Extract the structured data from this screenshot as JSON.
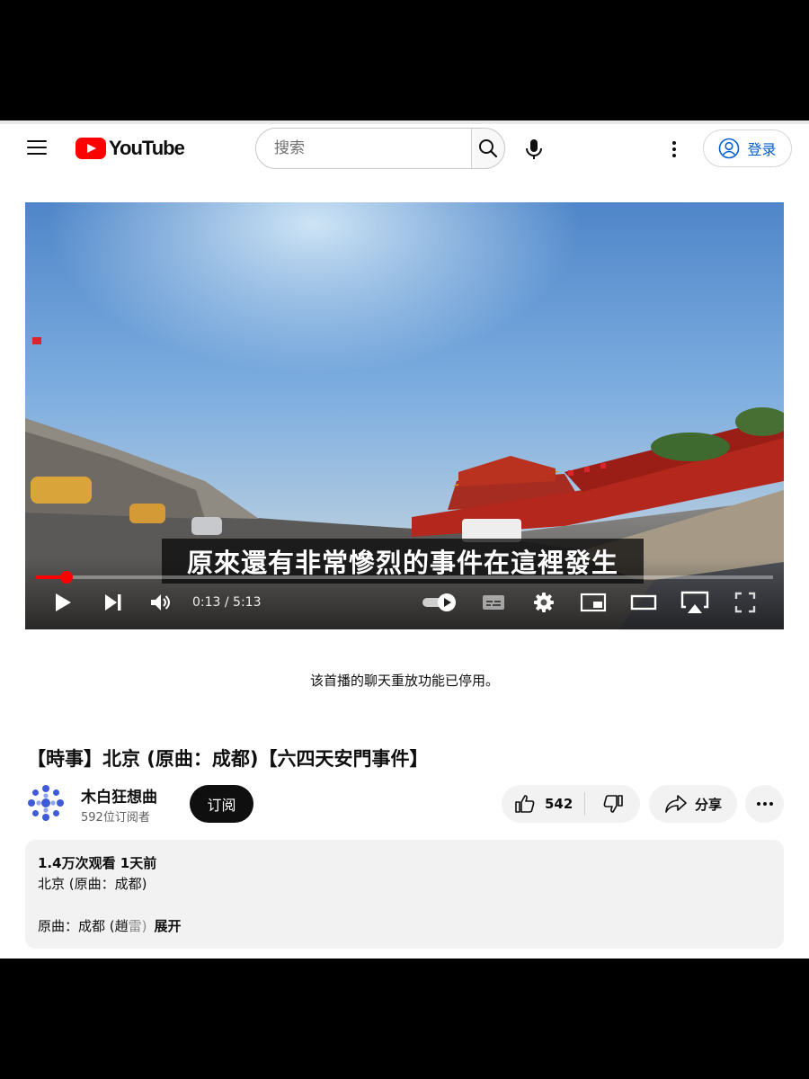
{
  "masthead": {
    "logo_text": "YouTube",
    "search_placeholder": "搜索",
    "signin_label": "登录"
  },
  "player": {
    "subtitle": "原來還有非常慘烈的事件在這裡發生",
    "time_display": "0:13 / 5:13",
    "current_time": "0:13",
    "duration": "5:13",
    "progress_fraction": 0.042,
    "accent_color": "#ff0000"
  },
  "chat_replay_notice": "该首播的聊天重放功能已停用。",
  "video": {
    "title": "【時事】北京 (原曲：成都)【六四天安門事件】",
    "channel_name": "木白狂想曲",
    "subscriber_count": "592位订阅者",
    "subscribe_label": "订阅",
    "like_count": "542",
    "share_label": "分享"
  },
  "description": {
    "meta": "1.4万次观看  1天前",
    "line1": "北京 (原曲：成都)",
    "line2_main": "原曲：成都 (趙",
    "line2_fade": "雷)",
    "expand_label": "展开"
  },
  "icons": {
    "menu": "hamburger-icon",
    "search": "search-icon",
    "mic": "microphone-icon",
    "more": "vertical-dots-icon",
    "account": "account-circle-icon",
    "play": "play-icon",
    "next": "next-icon",
    "volume": "volume-icon",
    "autoplay": "autoplay-toggle-icon",
    "captions": "captions-icon",
    "settings": "gear-icon",
    "miniplayer": "miniplayer-icon",
    "theater": "theater-mode-icon",
    "airplay": "airplay-icon",
    "fullscreen": "fullscreen-icon",
    "like": "thumbs-up-icon",
    "dislike": "thumbs-down-icon",
    "share": "share-arrow-icon",
    "overflow": "horizontal-dots-icon"
  }
}
